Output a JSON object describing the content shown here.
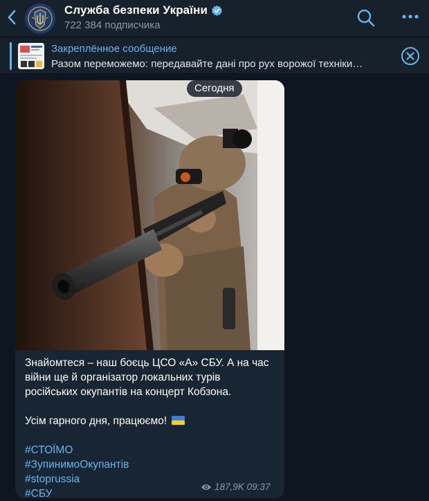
{
  "header": {
    "channel_name": "Служба безпеки України",
    "subscribers": "722 384 подписчика"
  },
  "pinned": {
    "label": "Закреплённое сообщение",
    "text": "Разом переможемо: передавайте дані про рух ворожої техніки…"
  },
  "message": {
    "date_badge": "Сегодня",
    "text_paragraph_1": "Знайомтеся – наш боєць ЦСО «А» СБУ. А на час війни ще й організатор локальних турів російських окупантів на концерт Кобзона.",
    "text_paragraph_2": "Усім гарного дня, працюємо!",
    "flag_emoji": "ukraine-flag",
    "hashtags": [
      "#СТОЇМО",
      "#ЗупинимоОкупантів",
      "#stoprussia",
      "#СБУ"
    ],
    "views": "187,9K",
    "time": "09:37"
  },
  "colors": {
    "background": "#0e1621",
    "header": "#17212b",
    "bubble": "#182533",
    "accent": "#64b5ef",
    "muted": "#8b98a5"
  },
  "icons": {
    "back": "chevron-left-icon",
    "verified": "verified-badge-icon",
    "search": "search-icon",
    "more": "more-dots-icon",
    "close": "close-circle-icon",
    "views": "eye-icon"
  }
}
